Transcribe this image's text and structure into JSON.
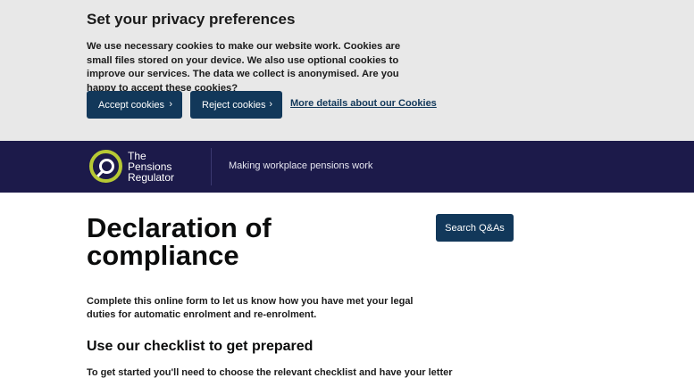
{
  "cookie_banner": {
    "title": "Set your privacy preferences",
    "text": "We use necessary cookies to make our website work. Cookies are small files stored on your device. We also use optional cookies to improve our services. The data we collect is anonymised. Are you happy to accept these cookies?",
    "accept_label": "Accept cookies",
    "reject_label": "Reject cookies",
    "details_link": "More details about our Cookies"
  },
  "header": {
    "logo_line1": "The",
    "logo_line2": "Pensions",
    "logo_line3": "Regulator",
    "tagline": "Making workplace pensions work"
  },
  "main": {
    "title": "Declaration of compliance",
    "search_label": "Search Q&As",
    "intro": "Complete this online form to let us know how you have met your legal duties for automatic enrolment and re-enrolment.",
    "subheading": "Use our checklist to get prepared",
    "partial_text": "To get started you'll need to choose the relevant checklist and have your letter"
  },
  "colors": {
    "banner_bg": "#e8e8e8",
    "button": "#12385a",
    "header_bg": "#1c1a4a",
    "logo_accent": "#b7c934"
  }
}
